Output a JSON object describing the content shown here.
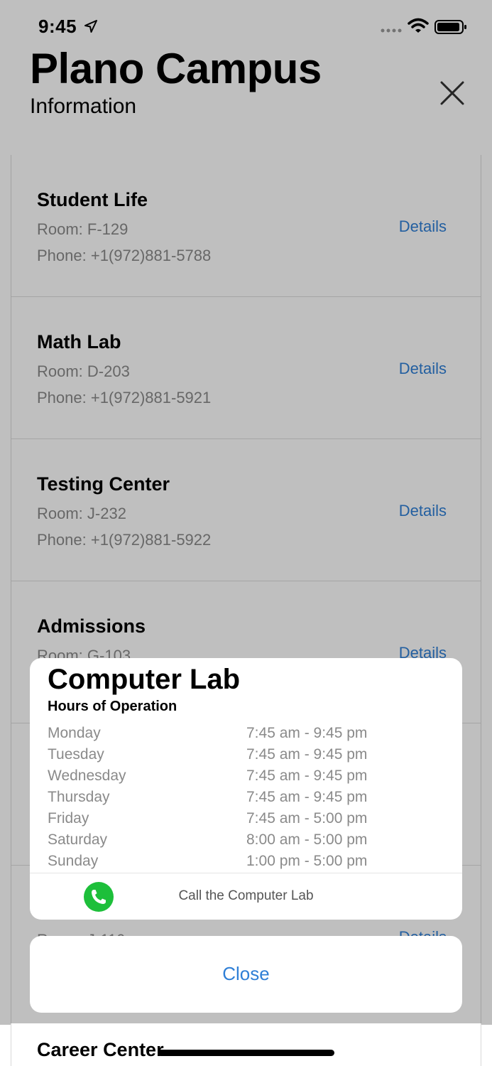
{
  "status_bar": {
    "time": "9:45"
  },
  "header": {
    "title": "Plano Campus",
    "subtitle": "Information"
  },
  "departments": [
    {
      "name": "Student Life",
      "room": "Room: F-129",
      "phone": "Phone: +1(972)881-5788",
      "details": "Details"
    },
    {
      "name": "Math Lab",
      "room": "Room: D-203",
      "phone": "Phone: +1(972)881-5921",
      "details": "Details"
    },
    {
      "name": "Testing Center",
      "room": "Room: J-232",
      "phone": "Phone: +1(972)881-5922",
      "details": "Details"
    },
    {
      "name": "Admissions",
      "room": "Room: G-103",
      "phone": "",
      "details": "Details"
    },
    {
      "name": "",
      "room": "",
      "phone": "",
      "details": ""
    },
    {
      "name": "",
      "room": "Room: J-110",
      "phone": "",
      "details": "Details"
    }
  ],
  "bottom_item": {
    "name": "Career Center"
  },
  "sheet": {
    "title": "Computer Lab",
    "subtitle": "Hours of Operation",
    "hours": [
      {
        "day": "Monday",
        "time": "7:45 am - 9:45 pm"
      },
      {
        "day": "Tuesday",
        "time": "7:45 am - 9:45 pm"
      },
      {
        "day": "Wednesday",
        "time": "7:45 am - 9:45 pm"
      },
      {
        "day": "Thursday",
        "time": "7:45 am - 9:45 pm"
      },
      {
        "day": "Friday",
        "time": "7:45 am - 5:00 pm"
      },
      {
        "day": "Saturday",
        "time": "8:00 am - 5:00 pm"
      },
      {
        "day": "Sunday",
        "time": "1:00 pm - 5:00 pm"
      }
    ],
    "call_label": "Call the Computer Lab",
    "close_label": "Close"
  },
  "colors": {
    "accent": "#2f7fd6",
    "call_green": "#1dbf3a",
    "secondary_text": "#8a8a8a"
  }
}
